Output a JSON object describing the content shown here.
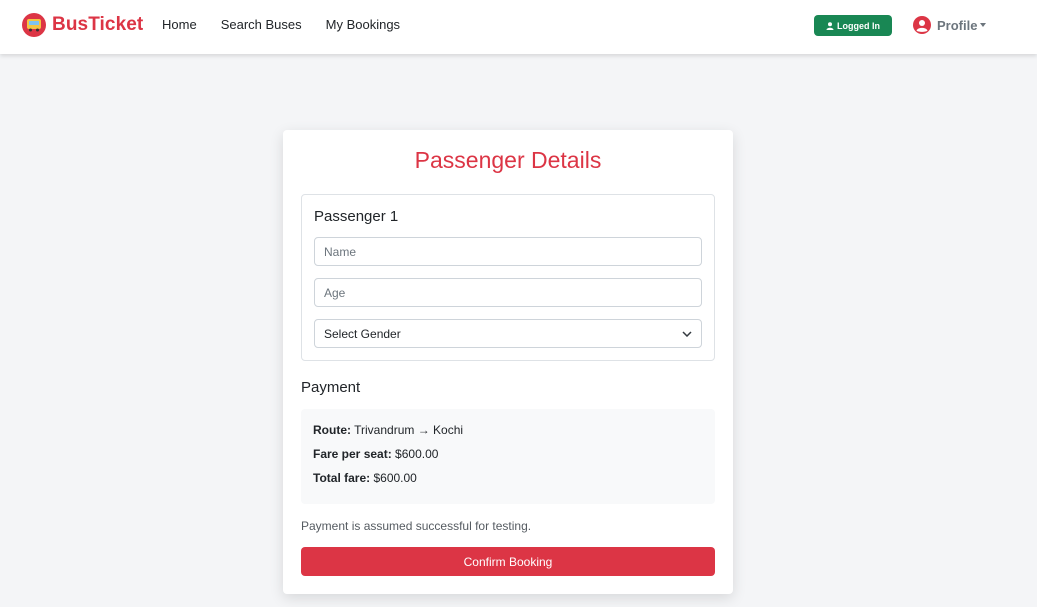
{
  "brand": {
    "name": "BusTicket",
    "color": "#dc3545",
    "icon": "bus-icon"
  },
  "nav": {
    "links": [
      {
        "label": "Home"
      },
      {
        "label": "Search Buses"
      },
      {
        "label": "My Bookings"
      }
    ],
    "status_badge": "Logged In",
    "status_icon": "user-icon",
    "profile_label": "Profile",
    "profile_icon": "user-circle-icon"
  },
  "card": {
    "title": "Passenger Details",
    "passenger": {
      "heading": "Passenger 1",
      "name_placeholder": "Name",
      "age_placeholder": "Age",
      "gender_selected": "Select Gender"
    },
    "payment": {
      "heading": "Payment",
      "route_label": "Route:",
      "route_value": "Trivandrum → Kochi",
      "fare_label": "Fare per seat:",
      "fare_value": "$600.00",
      "total_label": "Total fare:",
      "total_value": "$600.00"
    },
    "note": "Payment is assumed successful for testing.",
    "confirm_label": "Confirm Booking"
  },
  "colors": {
    "accent": "#dc3545",
    "success": "#198754"
  }
}
